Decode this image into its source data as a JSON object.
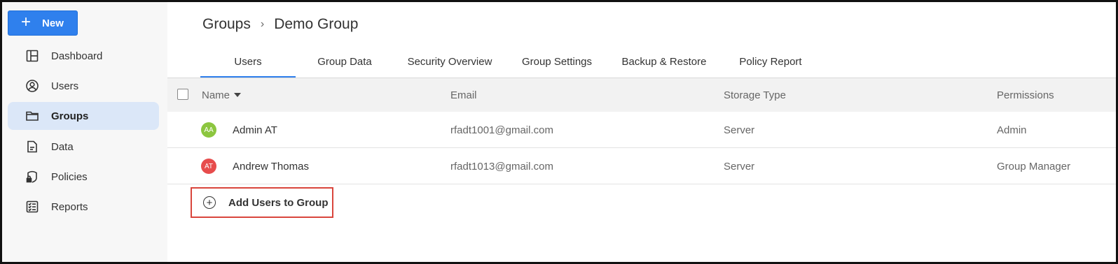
{
  "sidebar": {
    "new_label": "New",
    "items": [
      {
        "label": "Dashboard",
        "icon": "dashboard-icon"
      },
      {
        "label": "Users",
        "icon": "user-circle-icon"
      },
      {
        "label": "Groups",
        "icon": "folder-icon",
        "active": true
      },
      {
        "label": "Data",
        "icon": "document-icon"
      },
      {
        "label": "Policies",
        "icon": "policy-lock-icon"
      },
      {
        "label": "Reports",
        "icon": "checklist-icon"
      }
    ]
  },
  "breadcrumb": {
    "root": "Groups",
    "current": "Demo Group"
  },
  "tabs": [
    {
      "label": "Users",
      "active": true
    },
    {
      "label": "Group Data"
    },
    {
      "label": "Security Overview"
    },
    {
      "label": "Group Settings"
    },
    {
      "label": "Backup & Restore"
    },
    {
      "label": "Policy Report"
    }
  ],
  "table": {
    "headers": {
      "name": "Name",
      "email": "Email",
      "storage": "Storage Type",
      "permissions": "Permissions"
    },
    "rows": [
      {
        "initials": "AA",
        "avatar_color": "#8cc63f",
        "name": "Admin AT",
        "email": "rfadt1001@gmail.com",
        "storage": "Server",
        "permissions": "Admin"
      },
      {
        "initials": "AT",
        "avatar_color": "#e74c4c",
        "name": "Andrew Thomas",
        "email": "rfadt1013@gmail.com",
        "storage": "Server",
        "permissions": "Group Manager"
      }
    ]
  },
  "add_users_label": "Add Users to Group",
  "colors": {
    "accent": "#2f80ed",
    "highlight_box": "#d9453c"
  }
}
